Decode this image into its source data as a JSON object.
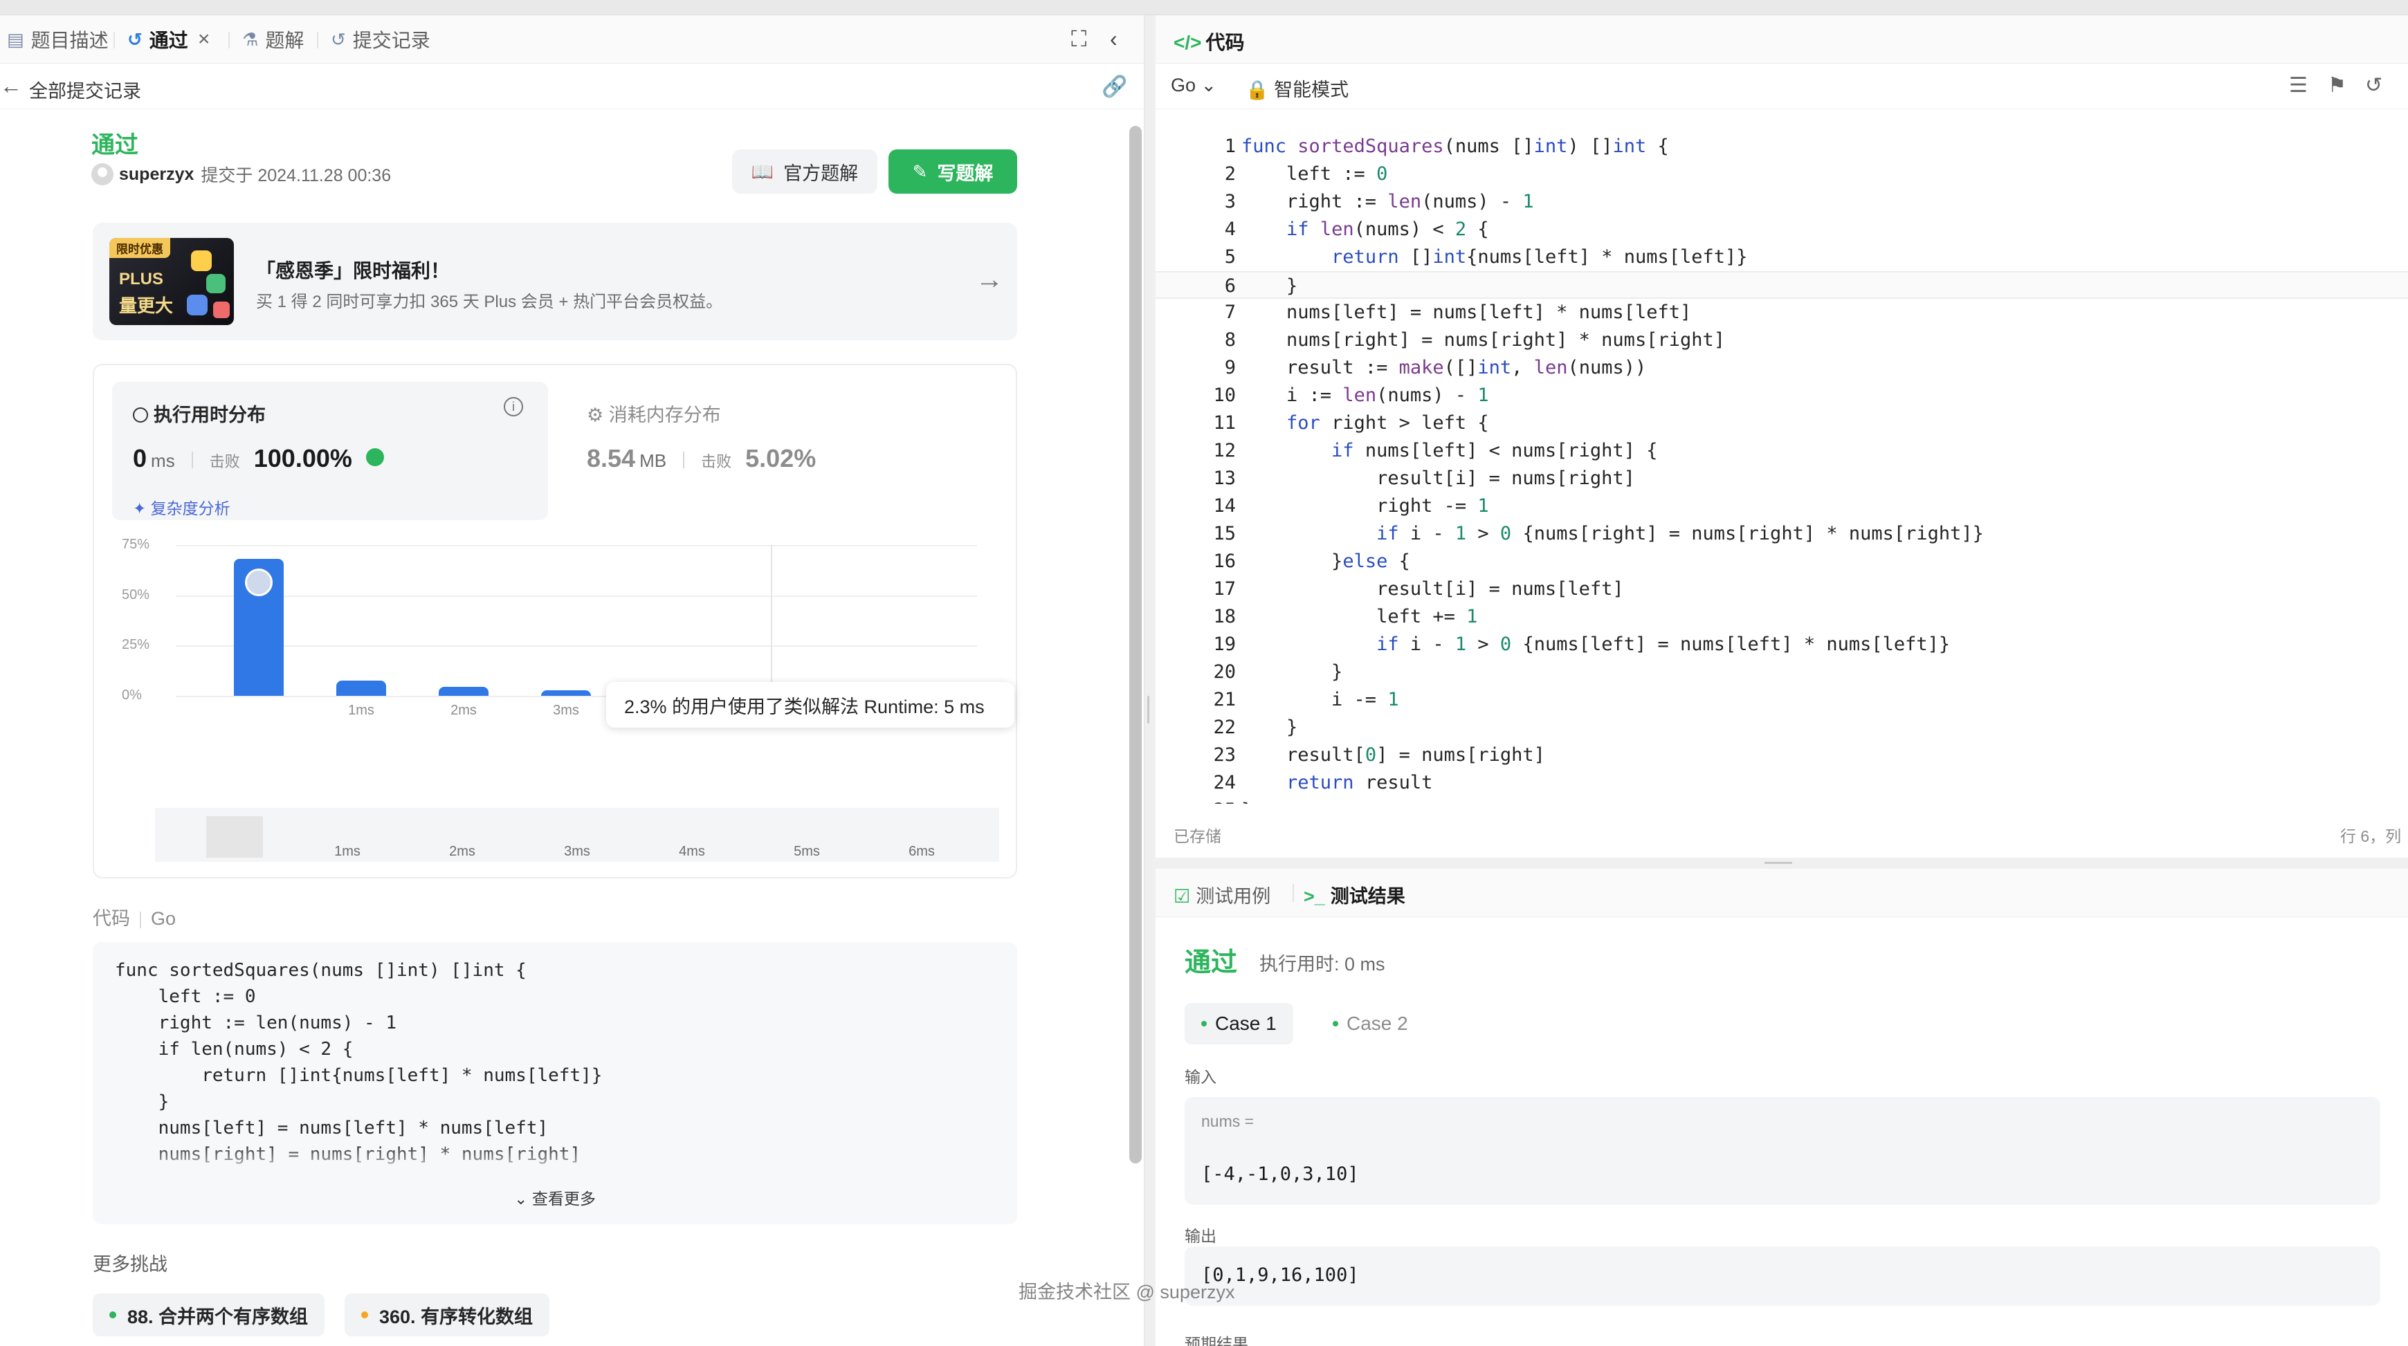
{
  "left_panel": {
    "tabs": [
      {
        "label": "题目描述",
        "icon": "doc-icon"
      },
      {
        "label": "通过",
        "icon": "history-icon",
        "closable": true
      },
      {
        "label": "题解",
        "icon": "flask-icon"
      },
      {
        "label": "提交记录",
        "icon": "history-icon"
      }
    ],
    "back_label": "全部提交记录",
    "submission": {
      "status": "通过",
      "user": "superzyx",
      "submitted_text": "提交于 2024.11.28 00:36",
      "official_solution_label": "官方题解",
      "write_solution_label": "写题解"
    },
    "promo": {
      "badge": "限时优惠",
      "plus": "PLUS",
      "big": "量更大",
      "title": "「感恩季」限时福利！",
      "desc": "买 1 得 2 同时可享力扣 365 天 Plus 会员 + 热门平台会员权益。"
    },
    "stats": {
      "runtime_title": "执行用时分布",
      "runtime_value": "0",
      "runtime_unit": "ms",
      "beat_label": "击败",
      "runtime_beat": "100.00%",
      "analysis_label": "复杂度分析",
      "memory_title": "消耗内存分布",
      "memory_value": "8.54",
      "memory_unit": "MB",
      "memory_beat": "5.02%"
    },
    "chart_data": {
      "type": "bar",
      "ytick_labels": [
        "75%",
        "50%",
        "25%",
        "0%"
      ],
      "categories": [
        "0ms",
        "1ms",
        "2ms",
        "3ms",
        "4ms",
        "5ms",
        "6ms"
      ],
      "xtick_labels": [
        "",
        "1ms",
        "2ms",
        "3ms",
        "4ms",
        "5ms",
        "6ms"
      ],
      "values": [
        68,
        7.5,
        4.5,
        2.5,
        6.5,
        2.3,
        2.5
      ],
      "ylim": [
        0,
        75
      ],
      "tooltip": "2.3% 的用户使用了类似解法 Runtime: 5 ms",
      "highlight_index": 0,
      "grid": true
    },
    "code_section": {
      "label": "代码",
      "lang": "Go",
      "code": "func sortedSquares(nums []int) []int {\n    left := 0\n    right := len(nums) - 1\n    if len(nums) < 2 {\n        return []int{nums[left] * nums[left]}\n    }\n    nums[left] = nums[left] * nums[left]\n    nums[right] = nums[right] * nums[right]",
      "more_label": "查看更多"
    },
    "more_challenges": {
      "title": "更多挑战",
      "items": [
        {
          "label": "88. 合并两个有序数组",
          "dot_color": "#2cb55d"
        },
        {
          "label": "360. 有序转化数组",
          "dot_color": "#f5a623"
        }
      ]
    }
  },
  "right_panel": {
    "title": "代码",
    "lang": "Go",
    "mode": "智能模式",
    "code_lines": [
      "func sortedSquares(nums []int) []int {",
      "    left := 0",
      "    right := len(nums) - 1",
      "    if len(nums) < 2 {",
      "        return []int{nums[left] * nums[left]}",
      "    }",
      "    nums[left] = nums[left] * nums[left]",
      "    nums[right] = nums[right] * nums[right]",
      "    result := make([]int, len(nums))",
      "    i := len(nums) - 1",
      "    for right > left {",
      "        if nums[left] < nums[right] {",
      "            result[i] = nums[right]",
      "            right -= 1",
      "            if i - 1 > 0 {nums[right] = nums[right] * nums[right]}",
      "        }else {",
      "            result[i] = nums[left]",
      "            left += 1",
      "            if i - 1 > 0 {nums[left] = nums[left] * nums[left]}",
      "        }",
      "        i -= 1",
      "    }",
      "    result[0] = nums[right]",
      "    return result",
      "}"
    ],
    "current_line": 6,
    "saved_label": "已存储",
    "cursor_pos": "行 6，列",
    "testcase_tab": "测试用例",
    "result_tab": "测试结果",
    "result": {
      "status": "通过",
      "runtime": "执行用时: 0 ms",
      "cases": [
        "Case 1",
        "Case 2"
      ],
      "input_label": "输入",
      "input_var": "nums =",
      "input_value": "[-4,-1,0,3,10]",
      "output_label": "输出",
      "output_value": "[0,1,9,16,100]",
      "expected_label": "预期结果"
    }
  },
  "watermark": "掘金技术社区 @ superzyx"
}
